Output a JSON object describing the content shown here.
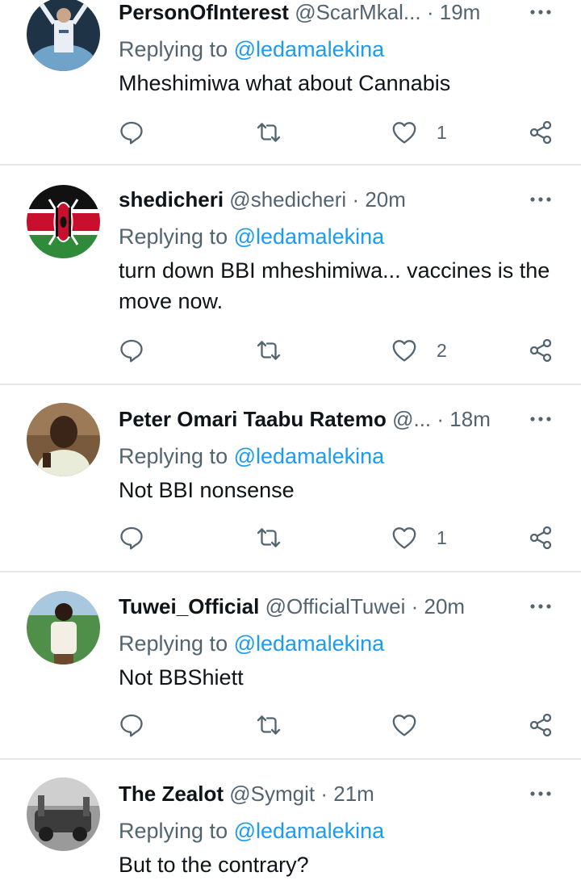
{
  "colors": {
    "accent": "#1d9bf0",
    "secondary_text": "#536471",
    "divider": "#e7e9ea"
  },
  "icons": {
    "reply": "reply-icon",
    "retweet": "retweet-icon",
    "like": "heart-icon",
    "share": "share-icon",
    "more": "more-icon"
  },
  "tweets": [
    {
      "name": "PersonOfInterest",
      "handle": "@ScarMkal...",
      "sep": "·",
      "time": "19m",
      "reply_prefix": "Replying to",
      "reply_to": "@ledamalekina",
      "text": "Mheshimiwa what about Cannabis",
      "likes": "1"
    },
    {
      "name": "shedicheri",
      "handle": "@shedicheri",
      "sep": "·",
      "time": "20m",
      "reply_prefix": "Replying to",
      "reply_to": "@ledamalekina",
      "text": "turn down BBI mheshimiwa... vaccines is the move now.",
      "likes": "2"
    },
    {
      "name": "Peter Omari Taabu Ratemo",
      "handle": "@...",
      "sep": "·",
      "time": "18m",
      "reply_prefix": "Replying to",
      "reply_to": "@ledamalekina",
      "text": "Not BBI nonsense",
      "likes": "1"
    },
    {
      "name": "Tuwei_Official",
      "handle": "@OfficialTuwei",
      "sep": "·",
      "time": "20m",
      "reply_prefix": "Replying to",
      "reply_to": "@ledamalekina",
      "text": "Not BBShiett",
      "likes": ""
    },
    {
      "name": "The Zealot",
      "handle": "@Symgit",
      "sep": "·",
      "time": "21m",
      "reply_prefix": "Replying to",
      "reply_to": "@ledamalekina",
      "text": "But to the contrary?",
      "likes": ""
    }
  ]
}
